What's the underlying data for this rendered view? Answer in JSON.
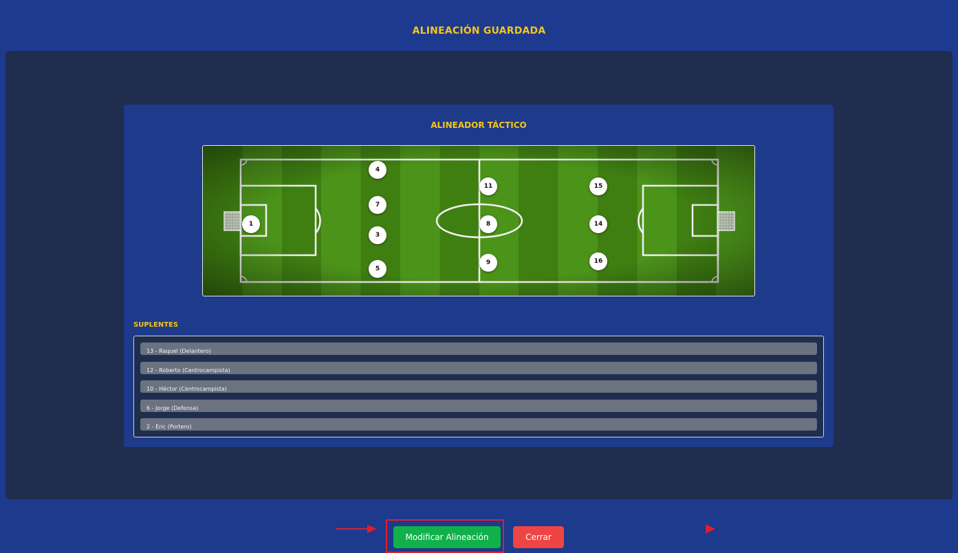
{
  "header": {
    "title": "ALINEACIÓN GUARDADA"
  },
  "tactical": {
    "title": "ALINEADOR TÁCTICO",
    "players": [
      {
        "number": "1"
      },
      {
        "number": "4"
      },
      {
        "number": "7"
      },
      {
        "number": "3"
      },
      {
        "number": "5"
      },
      {
        "number": "11"
      },
      {
        "number": "8"
      },
      {
        "number": "9"
      },
      {
        "number": "15"
      },
      {
        "number": "14"
      },
      {
        "number": "16"
      }
    ]
  },
  "substitutes": {
    "label": "SUPLENTES",
    "items": [
      {
        "label": "13 - Raquel (Delantero)"
      },
      {
        "label": "12 - Roberto (Centrocampista)"
      },
      {
        "label": "10 - Héctor (Centrocampista)"
      },
      {
        "label": "6 - Jorge (Defensa)"
      },
      {
        "label": "2 - Eric (Portero)"
      }
    ]
  },
  "actions": {
    "modify_label": "Modificar Alineación",
    "close_label": "Cerrar"
  },
  "colors": {
    "accent": "#f5c518",
    "background": "#1e3a8a",
    "panel": "#1f2d4e",
    "modify_button": "#10b14a",
    "close_button": "#ef4444",
    "annotation": "#e11d2f"
  },
  "annotations": {
    "arrow_icon": "arrow-right-icon",
    "triangle_icon": "play-triangle-icon"
  }
}
